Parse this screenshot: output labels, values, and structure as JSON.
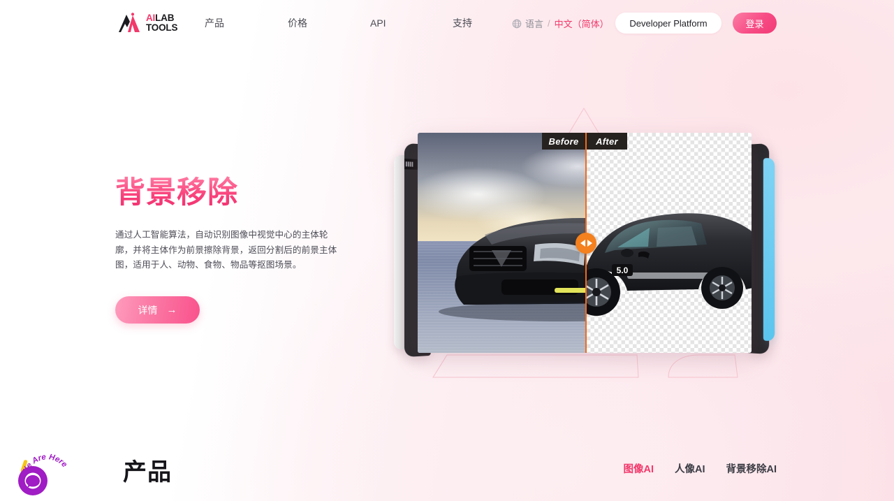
{
  "brand": {
    "logo_line1_accent": "AI",
    "logo_line1_rest": "LAB",
    "logo_line2": "TOOLS",
    "accent_color": "#f2396b",
    "dark_color": "#1b1b1f"
  },
  "header": {
    "nav": [
      {
        "label": "产品",
        "name": "nav-product"
      },
      {
        "label": "价格",
        "name": "nav-pricing"
      },
      {
        "label": "API",
        "name": "nav-api"
      },
      {
        "label": "支持",
        "name": "nav-support"
      }
    ],
    "language": {
      "icon": "globe-icon",
      "label": "语言",
      "separator": "/",
      "value": "中文（简体）"
    },
    "developer_platform_label": "Developer Platform",
    "login_label": "登录"
  },
  "hero": {
    "title": "背景移除",
    "description": "通过人工智能算法，自动识别图像中视觉中心的主体轮廓，并将主体作为前景擦除背景，返回分割后的前景主体图，适用于人、动物、食物、物品等抠图场景。",
    "cta_label": "详情",
    "cta_arrow": "→",
    "title_gradient_from": "#ff7ba3",
    "title_gradient_to": "#f12e6e"
  },
  "viewer": {
    "before_label": "Before",
    "after_label": "After",
    "divider_color": "#f26a1c",
    "handle_color": "#f4801e",
    "handle_left_icon": "chevron-left-icon",
    "handle_right_icon": "chevron-right-icon",
    "subject": "black sports car",
    "before_scene": "black sports car on a beach with dramatic cloudy sky",
    "after_scene": "black sports car cut out on transparent checkerboard background",
    "badge_text": "5.0"
  },
  "products_section": {
    "title": "产品",
    "tabs": [
      {
        "label": "图像AI",
        "active": true
      },
      {
        "label": "人像AI",
        "active": false
      },
      {
        "label": "背景移除AI",
        "active": false
      }
    ]
  },
  "chat_widget": {
    "bubble_text": "We Are Here!",
    "icon": "chat-bubble-icon",
    "color": "#a01cc4",
    "accent": "#f5c518"
  }
}
